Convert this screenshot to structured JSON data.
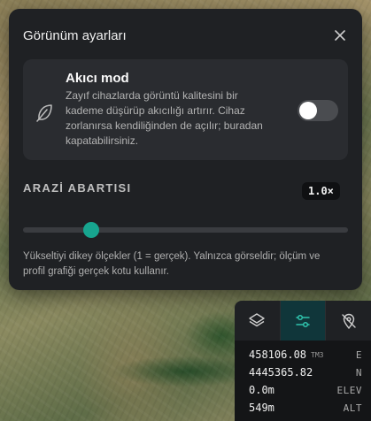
{
  "panel": {
    "title": "Görünüm ayarları",
    "fluid_mode": {
      "title": "Akıcı mod",
      "description": "Zayıf cihazlarda görüntü kalitesini bir kademe düşürüp akıcılığı artırır. Cihaz zorlanırsa kendiliğinden de açılır; buradan kapatabilirsiniz.",
      "enabled": false
    },
    "terrain": {
      "label": "ARAZİ ABARTISI",
      "value_label": "1.0×",
      "value": 1.0,
      "slider_fraction": 0.21,
      "help": "Yükseltiyi dikey ölçekler (1 = gerçek). Yalnızca görseldir; ölçüm ve profil grafiği gerçek kotu kullanır."
    }
  },
  "toolbar": {
    "tabs": [
      {
        "icon": "layers-icon",
        "active": false
      },
      {
        "icon": "sliders-icon",
        "active": true
      },
      {
        "icon": "location-off-icon",
        "active": false
      }
    ]
  },
  "coordinates": {
    "easting": {
      "value": "458106.08",
      "unit": "TM3",
      "key": "E"
    },
    "northing": {
      "value": "4445365.82",
      "key": "N"
    },
    "elevation": {
      "value": "0.0m",
      "key": "ELEV"
    },
    "altitude": {
      "value": "549m",
      "key": "ALT"
    }
  },
  "colors": {
    "accent": "#17a58f",
    "panel_bg": "#1f2124",
    "card_bg": "#2a2c30"
  }
}
